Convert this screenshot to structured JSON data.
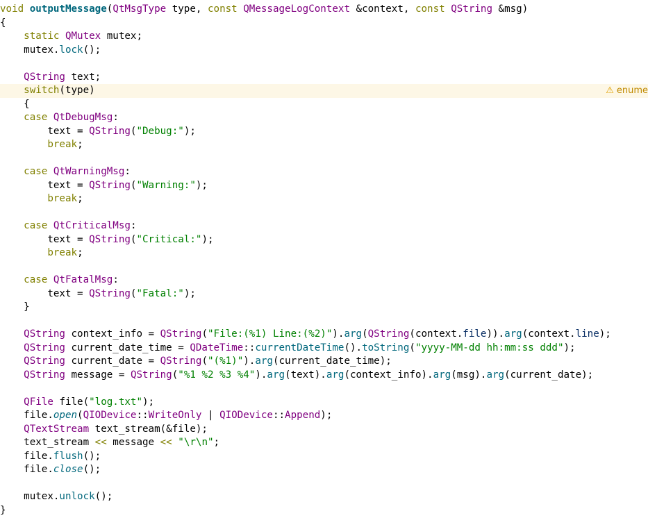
{
  "warning": {
    "icon": "warning-triangle-icon",
    "glyph": "⚠",
    "text": "enume"
  },
  "colors": {
    "keyword": "#808000",
    "function": "#00677c",
    "type": "#800080",
    "string": "#008000",
    "member": "#092e64",
    "warn_bg": "#fdf7e6"
  },
  "lines": [
    {
      "tokens": [
        {
          "t": "void ",
          "c": "kw"
        },
        {
          "t": "outputMessage",
          "c": "fndef"
        },
        {
          "t": "(",
          "c": "plain"
        },
        {
          "t": "QtMsgType",
          "c": "type"
        },
        {
          "t": " type, ",
          "c": "plain"
        },
        {
          "t": "const ",
          "c": "kw"
        },
        {
          "t": "QMessageLogContext",
          "c": "type"
        },
        {
          "t": " &context, ",
          "c": "plain"
        },
        {
          "t": "const ",
          "c": "kw"
        },
        {
          "t": "QString",
          "c": "type"
        },
        {
          "t": " &msg)",
          "c": "plain"
        }
      ]
    },
    {
      "tokens": [
        {
          "t": "{",
          "c": "plain"
        }
      ]
    },
    {
      "tokens": [
        {
          "t": "    ",
          "c": "plain"
        },
        {
          "t": "static ",
          "c": "kw"
        },
        {
          "t": "QMutex",
          "c": "type"
        },
        {
          "t": " mutex;",
          "c": "plain"
        }
      ]
    },
    {
      "tokens": [
        {
          "t": "    mutex.",
          "c": "plain"
        },
        {
          "t": "lock",
          "c": "fn"
        },
        {
          "t": "();",
          "c": "plain"
        }
      ]
    },
    {
      "tokens": []
    },
    {
      "tokens": [
        {
          "t": "    ",
          "c": "plain"
        },
        {
          "t": "QString",
          "c": "type"
        },
        {
          "t": " text;",
          "c": "plain"
        }
      ]
    },
    {
      "warn": true,
      "tokens": [
        {
          "t": "    ",
          "c": "plain"
        },
        {
          "t": "switch",
          "c": "kw"
        },
        {
          "t": "(type)",
          "c": "plain"
        }
      ]
    },
    {
      "tokens": [
        {
          "t": "    {",
          "c": "plain"
        }
      ]
    },
    {
      "tokens": [
        {
          "t": "    ",
          "c": "plain"
        },
        {
          "t": "case ",
          "c": "kw"
        },
        {
          "t": "QtDebugMsg",
          "c": "enum"
        },
        {
          "t": ":",
          "c": "plain"
        }
      ]
    },
    {
      "tokens": [
        {
          "t": "        text = ",
          "c": "plain"
        },
        {
          "t": "QString",
          "c": "type"
        },
        {
          "t": "(",
          "c": "plain"
        },
        {
          "t": "\"Debug:\"",
          "c": "str"
        },
        {
          "t": ");",
          "c": "plain"
        }
      ]
    },
    {
      "tokens": [
        {
          "t": "        ",
          "c": "plain"
        },
        {
          "t": "break",
          "c": "kw"
        },
        {
          "t": ";",
          "c": "plain"
        }
      ]
    },
    {
      "tokens": []
    },
    {
      "tokens": [
        {
          "t": "    ",
          "c": "plain"
        },
        {
          "t": "case ",
          "c": "kw"
        },
        {
          "t": "QtWarningMsg",
          "c": "enum"
        },
        {
          "t": ":",
          "c": "plain"
        }
      ]
    },
    {
      "tokens": [
        {
          "t": "        text = ",
          "c": "plain"
        },
        {
          "t": "QString",
          "c": "type"
        },
        {
          "t": "(",
          "c": "plain"
        },
        {
          "t": "\"Warning:\"",
          "c": "str"
        },
        {
          "t": ");",
          "c": "plain"
        }
      ]
    },
    {
      "tokens": [
        {
          "t": "        ",
          "c": "plain"
        },
        {
          "t": "break",
          "c": "kw"
        },
        {
          "t": ";",
          "c": "plain"
        }
      ]
    },
    {
      "tokens": []
    },
    {
      "tokens": [
        {
          "t": "    ",
          "c": "plain"
        },
        {
          "t": "case ",
          "c": "kw"
        },
        {
          "t": "QtCriticalMsg",
          "c": "enum"
        },
        {
          "t": ":",
          "c": "plain"
        }
      ]
    },
    {
      "tokens": [
        {
          "t": "        text = ",
          "c": "plain"
        },
        {
          "t": "QString",
          "c": "type"
        },
        {
          "t": "(",
          "c": "plain"
        },
        {
          "t": "\"Critical:\"",
          "c": "str"
        },
        {
          "t": ");",
          "c": "plain"
        }
      ]
    },
    {
      "tokens": [
        {
          "t": "        ",
          "c": "plain"
        },
        {
          "t": "break",
          "c": "kw"
        },
        {
          "t": ";",
          "c": "plain"
        }
      ]
    },
    {
      "tokens": []
    },
    {
      "tokens": [
        {
          "t": "    ",
          "c": "plain"
        },
        {
          "t": "case ",
          "c": "kw"
        },
        {
          "t": "QtFatalMsg",
          "c": "enum"
        },
        {
          "t": ":",
          "c": "plain"
        }
      ]
    },
    {
      "tokens": [
        {
          "t": "        text = ",
          "c": "plain"
        },
        {
          "t": "QString",
          "c": "type"
        },
        {
          "t": "(",
          "c": "plain"
        },
        {
          "t": "\"Fatal:\"",
          "c": "str"
        },
        {
          "t": ");",
          "c": "plain"
        }
      ]
    },
    {
      "tokens": [
        {
          "t": "    }",
          "c": "plain"
        }
      ]
    },
    {
      "tokens": []
    },
    {
      "tokens": [
        {
          "t": "    ",
          "c": "plain"
        },
        {
          "t": "QString",
          "c": "type"
        },
        {
          "t": " context_info = ",
          "c": "plain"
        },
        {
          "t": "QString",
          "c": "type"
        },
        {
          "t": "(",
          "c": "plain"
        },
        {
          "t": "\"File:(%1) Line:(%2)\"",
          "c": "str"
        },
        {
          "t": ").",
          "c": "plain"
        },
        {
          "t": "arg",
          "c": "fn"
        },
        {
          "t": "(",
          "c": "plain"
        },
        {
          "t": "QString",
          "c": "type"
        },
        {
          "t": "(context.",
          "c": "plain"
        },
        {
          "t": "file",
          "c": "var"
        },
        {
          "t": ")).",
          "c": "plain"
        },
        {
          "t": "arg",
          "c": "fn"
        },
        {
          "t": "(context.",
          "c": "plain"
        },
        {
          "t": "line",
          "c": "var"
        },
        {
          "t": ");",
          "c": "plain"
        }
      ]
    },
    {
      "tokens": [
        {
          "t": "    ",
          "c": "plain"
        },
        {
          "t": "QString",
          "c": "type"
        },
        {
          "t": " current_date_time = ",
          "c": "plain"
        },
        {
          "t": "QDateTime",
          "c": "type"
        },
        {
          "t": "::",
          "c": "plain"
        },
        {
          "t": "currentDateTime",
          "c": "fn"
        },
        {
          "t": "().",
          "c": "plain"
        },
        {
          "t": "toString",
          "c": "fn"
        },
        {
          "t": "(",
          "c": "plain"
        },
        {
          "t": "\"yyyy-MM-dd hh:mm:ss ddd\"",
          "c": "str"
        },
        {
          "t": ");",
          "c": "plain"
        }
      ]
    },
    {
      "tokens": [
        {
          "t": "    ",
          "c": "plain"
        },
        {
          "t": "QString",
          "c": "type"
        },
        {
          "t": " current_date = ",
          "c": "plain"
        },
        {
          "t": "QString",
          "c": "type"
        },
        {
          "t": "(",
          "c": "plain"
        },
        {
          "t": "\"(%1)\"",
          "c": "str"
        },
        {
          "t": ").",
          "c": "plain"
        },
        {
          "t": "arg",
          "c": "fn"
        },
        {
          "t": "(current_date_time);",
          "c": "plain"
        }
      ]
    },
    {
      "tokens": [
        {
          "t": "    ",
          "c": "plain"
        },
        {
          "t": "QString",
          "c": "type"
        },
        {
          "t": " message = ",
          "c": "plain"
        },
        {
          "t": "QString",
          "c": "type"
        },
        {
          "t": "(",
          "c": "plain"
        },
        {
          "t": "\"%1 %2 %3 %4\"",
          "c": "str"
        },
        {
          "t": ").",
          "c": "plain"
        },
        {
          "t": "arg",
          "c": "fn"
        },
        {
          "t": "(text).",
          "c": "plain"
        },
        {
          "t": "arg",
          "c": "fn"
        },
        {
          "t": "(context_info).",
          "c": "plain"
        },
        {
          "t": "arg",
          "c": "fn"
        },
        {
          "t": "(msg).",
          "c": "plain"
        },
        {
          "t": "arg",
          "c": "fn"
        },
        {
          "t": "(current_date);",
          "c": "plain"
        }
      ]
    },
    {
      "tokens": []
    },
    {
      "tokens": [
        {
          "t": "    ",
          "c": "plain"
        },
        {
          "t": "QFile",
          "c": "type"
        },
        {
          "t": " file(",
          "c": "plain"
        },
        {
          "t": "\"log.txt\"",
          "c": "str"
        },
        {
          "t": ");",
          "c": "plain"
        }
      ]
    },
    {
      "tokens": [
        {
          "t": "    file.",
          "c": "plain"
        },
        {
          "t": "open",
          "c": "fn-it"
        },
        {
          "t": "(",
          "c": "plain"
        },
        {
          "t": "QIODevice",
          "c": "type"
        },
        {
          "t": "::",
          "c": "plain"
        },
        {
          "t": "WriteOnly",
          "c": "enum"
        },
        {
          "t": " | ",
          "c": "plain"
        },
        {
          "t": "QIODevice",
          "c": "type"
        },
        {
          "t": "::",
          "c": "plain"
        },
        {
          "t": "Append",
          "c": "enum"
        },
        {
          "t": ");",
          "c": "plain"
        }
      ]
    },
    {
      "tokens": [
        {
          "t": "    ",
          "c": "plain"
        },
        {
          "t": "QTextStream",
          "c": "type"
        },
        {
          "t": " text_stream(&file);",
          "c": "plain"
        }
      ]
    },
    {
      "tokens": [
        {
          "t": "    text_stream ",
          "c": "plain"
        },
        {
          "t": "<<",
          "c": "kw"
        },
        {
          "t": " message ",
          "c": "plain"
        },
        {
          "t": "<<",
          "c": "kw"
        },
        {
          "t": " ",
          "c": "plain"
        },
        {
          "t": "\"\\r\\n\"",
          "c": "str"
        },
        {
          "t": ";",
          "c": "plain"
        }
      ]
    },
    {
      "tokens": [
        {
          "t": "    file.",
          "c": "plain"
        },
        {
          "t": "flush",
          "c": "fn"
        },
        {
          "t": "();",
          "c": "plain"
        }
      ]
    },
    {
      "tokens": [
        {
          "t": "    file.",
          "c": "plain"
        },
        {
          "t": "close",
          "c": "fn-it"
        },
        {
          "t": "();",
          "c": "plain"
        }
      ]
    },
    {
      "tokens": []
    },
    {
      "tokens": [
        {
          "t": "    mutex.",
          "c": "plain"
        },
        {
          "t": "unlock",
          "c": "fn"
        },
        {
          "t": "();",
          "c": "plain"
        }
      ]
    },
    {
      "tokens": [
        {
          "t": "}",
          "c": "plain"
        }
      ]
    }
  ]
}
